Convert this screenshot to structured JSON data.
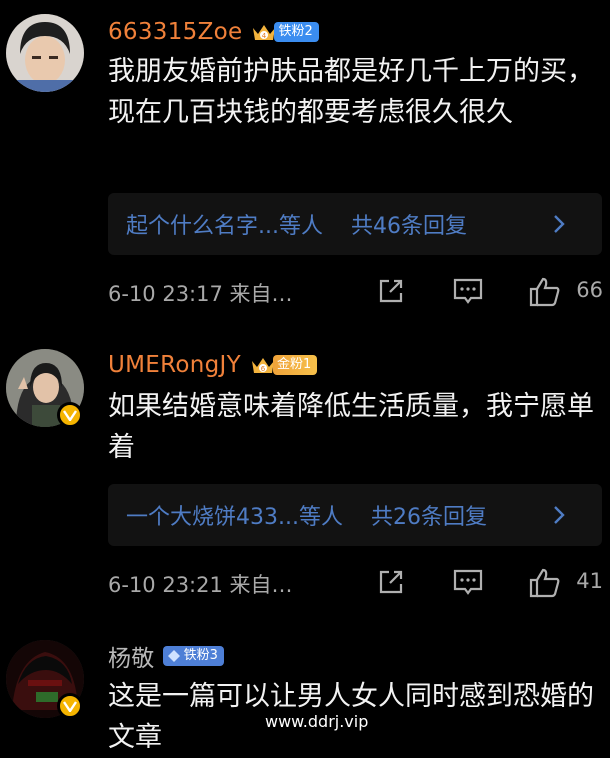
{
  "comments": [
    {
      "username": "663315Zoe",
      "badge_level": "铁粉2",
      "content": "我朋友婚前护肤品都是好几千上万的买，现在几百块钱的都要考虑很久很久",
      "reply_preview": "起个什么名字...等人",
      "reply_count": "共46条回复",
      "time": "6-10  23:17  来自…",
      "likes": "66"
    },
    {
      "username": "UMERongJY",
      "badge_level": "金粉1",
      "content": "如果结婚意味着降低生活质量，我宁愿单着",
      "reply_preview": "一个大烧饼433...等人",
      "reply_count": "共26条回复",
      "time": "6-10  23:21  来自…",
      "likes": "41"
    },
    {
      "username": "杨敬",
      "badge_level": "铁粉3",
      "content": "这是一篇可以让男人女人同时感到恐婚的文章"
    }
  ],
  "watermark": "www.ddrj.vip",
  "colors": {
    "username": "#f0813a",
    "link": "#4f7cc4",
    "verified": "#f5b400"
  }
}
